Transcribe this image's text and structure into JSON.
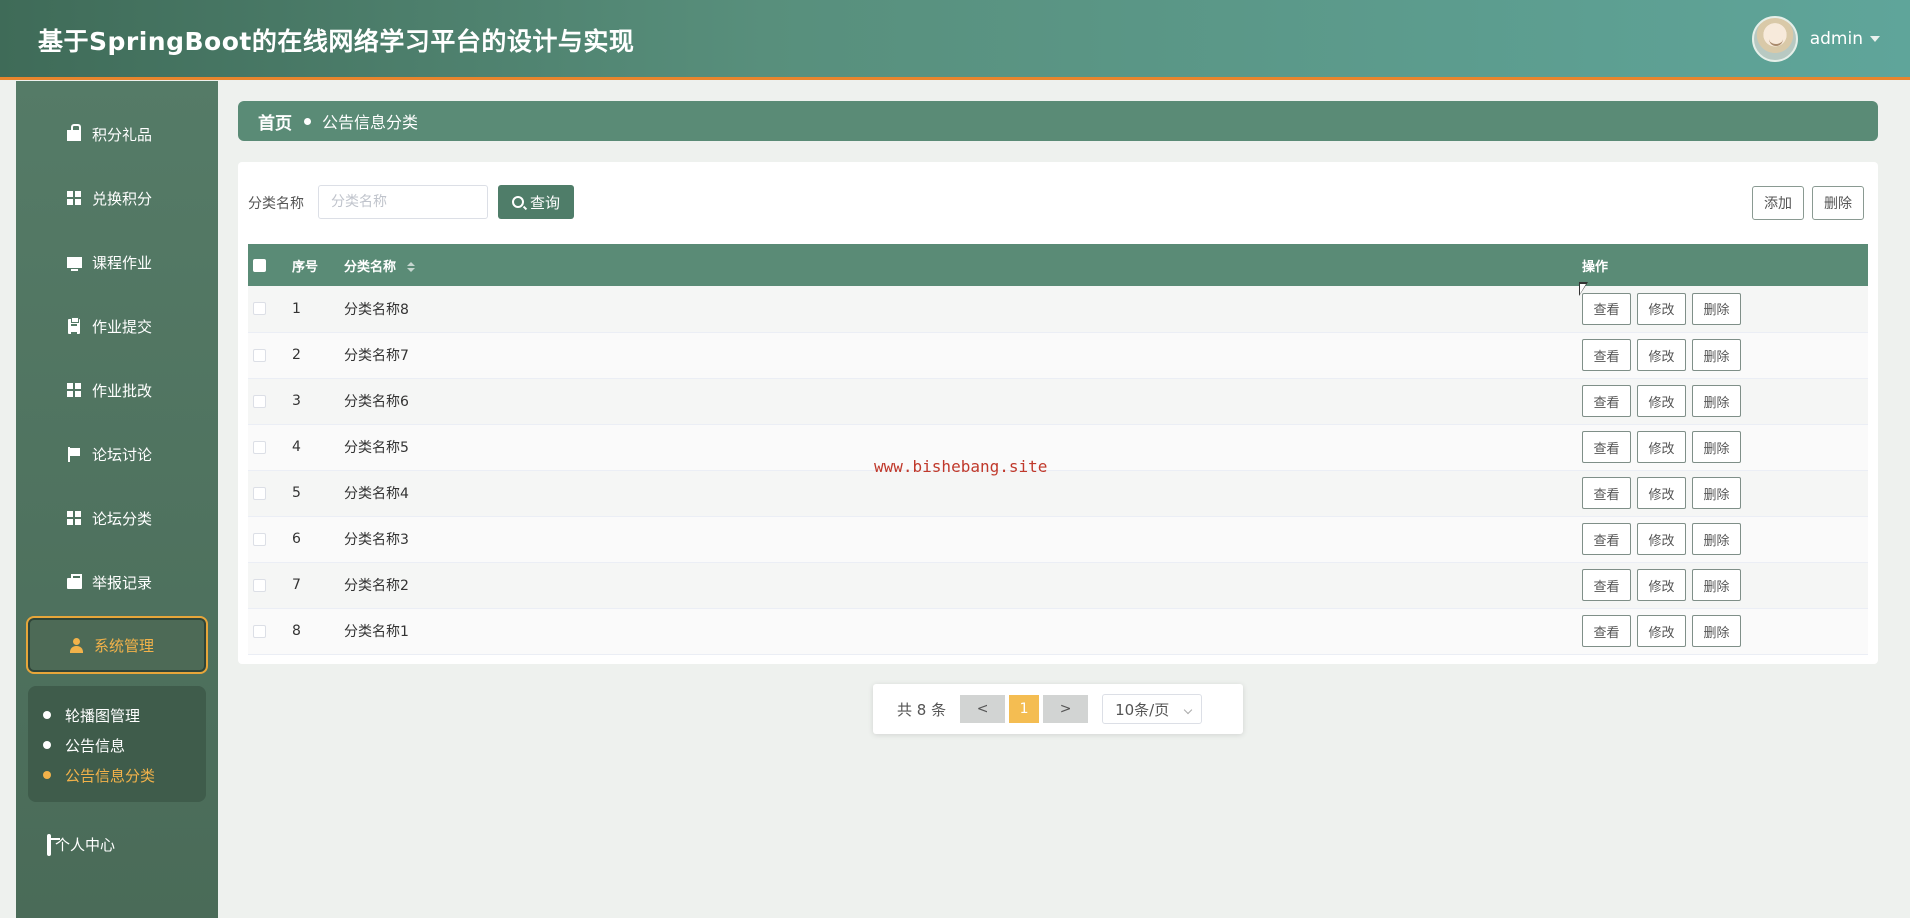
{
  "header": {
    "title": "基于SpringBoot的在线网络学习平台的设计与实现",
    "user": "admin"
  },
  "sidebar": {
    "items": [
      {
        "label": "积分礼品",
        "icon": "gift-icon"
      },
      {
        "label": "兑换积分",
        "icon": "grid-icon"
      },
      {
        "label": "课程作业",
        "icon": "monitor-icon"
      },
      {
        "label": "作业提交",
        "icon": "clipboard-icon"
      },
      {
        "label": "作业批改",
        "icon": "grid-icon"
      },
      {
        "label": "论坛讨论",
        "icon": "flag-icon"
      },
      {
        "label": "论坛分类",
        "icon": "grid-icon"
      },
      {
        "label": "举报记录",
        "icon": "briefcase-icon"
      },
      {
        "label": "系统管理",
        "icon": "user-icon",
        "active": true
      }
    ],
    "submenu": [
      {
        "label": "轮播图管理"
      },
      {
        "label": "公告信息"
      },
      {
        "label": "公告信息分类",
        "active": true
      }
    ],
    "personal": "个人中心"
  },
  "breadcrumb": {
    "home": "首页",
    "current": "公告信息分类"
  },
  "search": {
    "label": "分类名称",
    "placeholder": "分类名称",
    "button": "查询"
  },
  "toolbar": {
    "add": "添加",
    "delete": "删除"
  },
  "table": {
    "headers": {
      "index": "序号",
      "name": "分类名称",
      "actions": "操作"
    },
    "rows": [
      {
        "index": "1",
        "name": "分类名称8"
      },
      {
        "index": "2",
        "name": "分类名称7"
      },
      {
        "index": "3",
        "name": "分类名称6"
      },
      {
        "index": "4",
        "name": "分类名称5"
      },
      {
        "index": "5",
        "name": "分类名称4"
      },
      {
        "index": "6",
        "name": "分类名称3"
      },
      {
        "index": "7",
        "name": "分类名称2"
      },
      {
        "index": "8",
        "name": "分类名称1"
      }
    ],
    "row_actions": {
      "view": "查看",
      "edit": "修改",
      "delete": "删除"
    }
  },
  "pagination": {
    "total": "共 8 条",
    "prev": "<",
    "page": "1",
    "next": ">",
    "page_size": "10条/页"
  },
  "watermark": "www.bishebang.site",
  "colors": {
    "primary": "#5a8b76",
    "accent": "#f2b24a",
    "header_border": "#e8852d"
  }
}
